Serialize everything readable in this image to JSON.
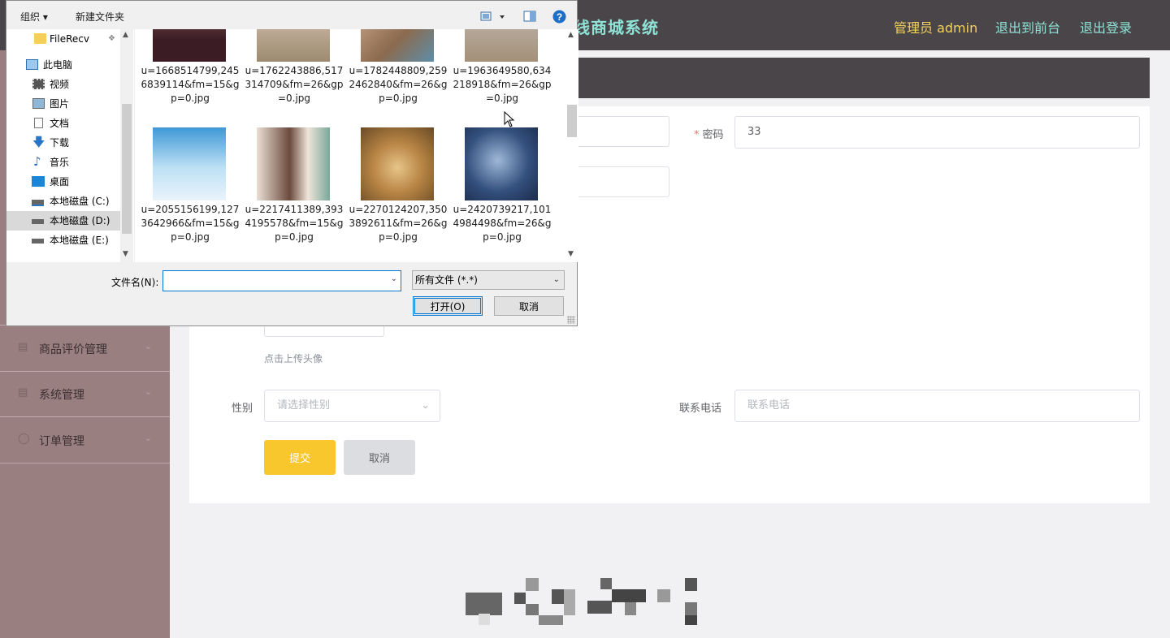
{
  "app": {
    "title": "线商城系统",
    "admin_label": "管理员 admin",
    "to_front": "退出到前台",
    "logout": "退出登录"
  },
  "sidebar": {
    "items": [
      {
        "label": "商品评价管理",
        "icon": "briefcase-icon"
      },
      {
        "label": "系统管理",
        "icon": "clipboard-icon"
      },
      {
        "label": "订单管理",
        "icon": "circle-icon"
      }
    ]
  },
  "form": {
    "password_label": "密码",
    "password_value": "33",
    "upload_tip": "点击上传头像",
    "gender_label": "性别",
    "gender_placeholder": "请选择性别",
    "phone_label": "联系电话",
    "phone_placeholder": "联系电话",
    "submit_label": "提交",
    "cancel_label": "取消"
  },
  "dialog": {
    "organize": "组织 ▾",
    "new_folder": "新建文件夹",
    "nav": [
      {
        "label": "FileRecv",
        "icon": "folder-icon"
      },
      {
        "label": "此电脑",
        "icon": "computer-icon"
      },
      {
        "label": "视频",
        "icon": "video-icon"
      },
      {
        "label": "图片",
        "icon": "picture-icon"
      },
      {
        "label": "文档",
        "icon": "document-icon"
      },
      {
        "label": "下载",
        "icon": "download-icon"
      },
      {
        "label": "音乐",
        "icon": "music-icon"
      },
      {
        "label": "桌面",
        "icon": "desktop-icon"
      },
      {
        "label": "本地磁盘 (C:)",
        "icon": "drive-icon"
      },
      {
        "label": "本地磁盘 (D:)",
        "icon": "drive-icon"
      },
      {
        "label": "本地磁盘 (E:)",
        "icon": "drive-icon"
      }
    ],
    "files": [
      {
        "name": "u=1668514799,2456839114&fm=15&gp=0.jpg"
      },
      {
        "name": "u=1762243886,517314709&fm=26&gp=0.jpg"
      },
      {
        "name": "u=1782448809,2592462840&fm=26&gp=0.jpg"
      },
      {
        "name": "u=1963649580,634218918&fm=26&gp=0.jpg"
      },
      {
        "name": "u=2055156199,1273642966&fm=15&gp=0.jpg"
      },
      {
        "name": "u=2217411389,3934195578&fm=15&gp=0.jpg"
      },
      {
        "name": "u=2270124207,3503892611&fm=26&gp=0.jpg"
      },
      {
        "name": "u=2420739217,1014984498&fm=26&gp=0.jpg"
      }
    ],
    "filename_label": "文件名(N):",
    "filename_value": "",
    "filetype": "所有文件 (*.*)",
    "open_label": "打开(O)",
    "cancel_label": "取消",
    "help_icon": "?"
  }
}
